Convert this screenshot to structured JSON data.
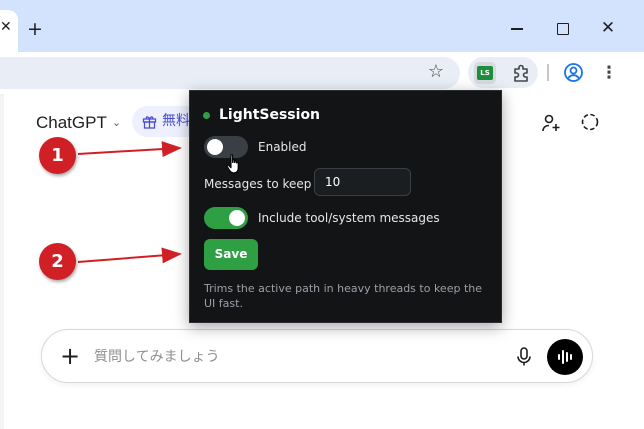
{
  "browser": {
    "tab_close_glyph": "✕",
    "new_tab_glyph": "+",
    "window_close_glyph": "✕",
    "star_glyph": "☆",
    "menu_glyph": "⋮",
    "extension_badge": "LS"
  },
  "page": {
    "model_name": "ChatGPT",
    "model_chevron": "⌄",
    "promo_text": "無料",
    "composer": {
      "plus_glyph": "+",
      "placeholder": "質問してみましょう"
    }
  },
  "popup": {
    "title": "LightSession",
    "enabled_label": "Enabled",
    "enabled_on": false,
    "messages_label": "Messages to keep",
    "messages_value": "10",
    "include_label": "Include tool/system messages",
    "include_on": true,
    "save_label": "Save",
    "help_text": "Trims the active path in heavy threads to keep the UI fast."
  },
  "annotations": {
    "badge_1": "1",
    "badge_2": "2"
  },
  "colors": {
    "accent_green": "#2ea043",
    "annotation_red": "#d11f26",
    "popup_bg": "#121416",
    "chrome_tabstrip": "#d3e3fd"
  }
}
